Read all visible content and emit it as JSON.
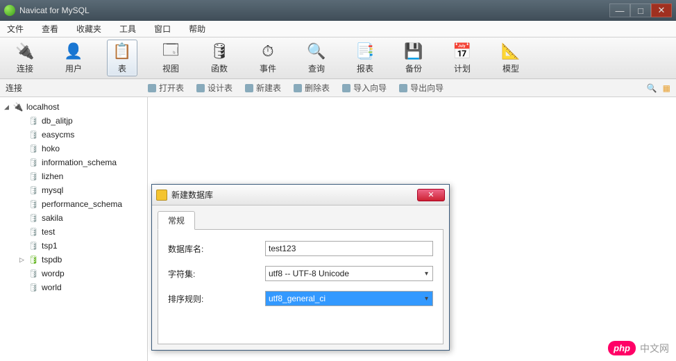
{
  "window": {
    "title": "Navicat for MySQL"
  },
  "menubar": [
    "文件",
    "查看",
    "收藏夹",
    "工具",
    "窗口",
    "帮助"
  ],
  "toolbar": [
    {
      "label": "连接",
      "icon": "🔌"
    },
    {
      "label": "用户",
      "icon": "👤"
    },
    {
      "label": "表",
      "icon": "📋",
      "active": true
    },
    {
      "label": "视图",
      "icon": "🗔"
    },
    {
      "label": "函数",
      "icon": "🛢"
    },
    {
      "label": "事件",
      "icon": "⏱"
    },
    {
      "label": "查询",
      "icon": "🔍"
    },
    {
      "label": "报表",
      "icon": "📑"
    },
    {
      "label": "备份",
      "icon": "💾"
    },
    {
      "label": "计划",
      "icon": "📅"
    },
    {
      "label": "模型",
      "icon": "📐"
    }
  ],
  "subtoolbar": {
    "head": "连接",
    "actions": [
      "打开表",
      "设计表",
      "新建表",
      "删除表",
      "导入向导",
      "导出向导"
    ]
  },
  "tree": {
    "root": {
      "label": "localhost",
      "expanded": true
    },
    "dbs": [
      {
        "label": "db_alitjp"
      },
      {
        "label": "easycms"
      },
      {
        "label": "hoko"
      },
      {
        "label": "information_schema"
      },
      {
        "label": "lizhen"
      },
      {
        "label": "mysql"
      },
      {
        "label": "performance_schema"
      },
      {
        "label": "sakila"
      },
      {
        "label": "test"
      },
      {
        "label": "tsp1"
      },
      {
        "label": "tspdb",
        "green": true,
        "expandable": true
      },
      {
        "label": "wordp"
      },
      {
        "label": "world"
      }
    ]
  },
  "dialog": {
    "title": "新建数据库",
    "tab": "常规",
    "fields": {
      "dbname_label": "数据库名:",
      "dbname_value": "test123",
      "charset_label": "字符集:",
      "charset_value": "utf8 -- UTF-8 Unicode",
      "collation_label": "排序规则:",
      "collation_value": "utf8_general_ci"
    }
  },
  "watermark": {
    "badge": "php",
    "text": "中文网"
  }
}
